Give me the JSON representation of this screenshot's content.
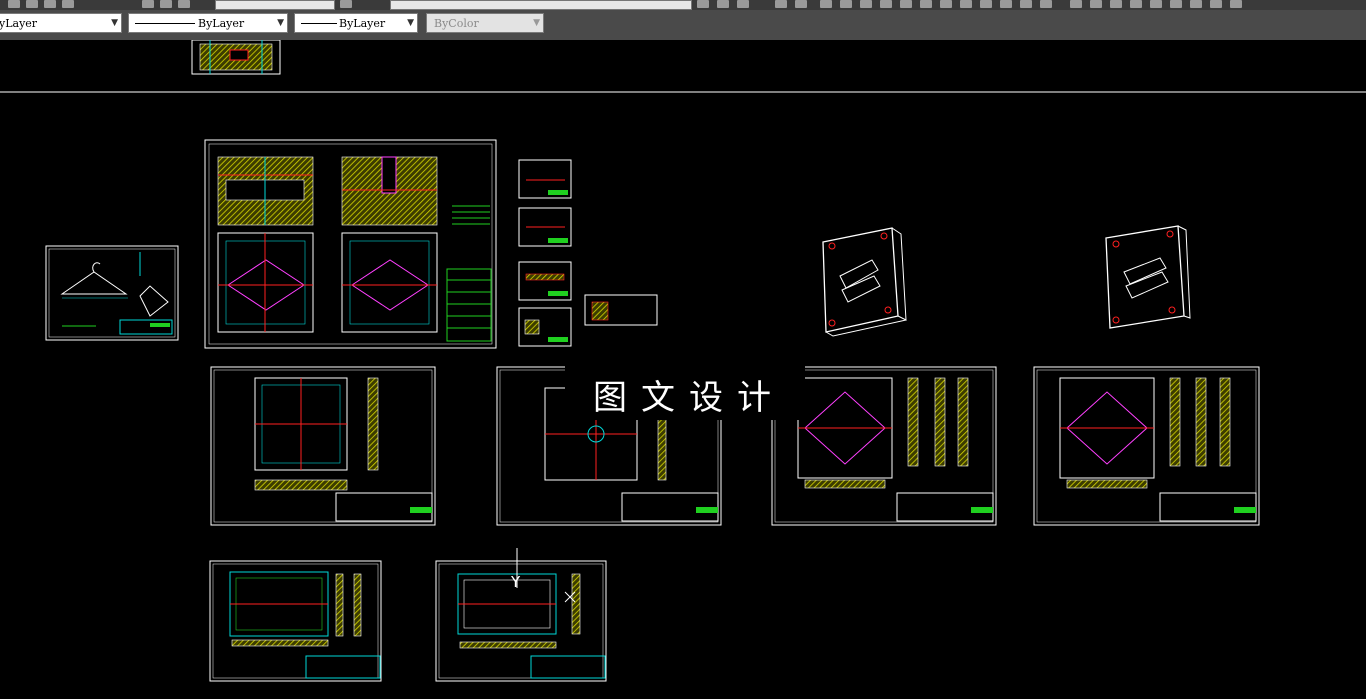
{
  "toolbar": {
    "file_tab_hint": "",
    "layer_tab_hint": ""
  },
  "properties": {
    "layer_value": "yLayer",
    "linetype_value": "ByLayer",
    "lineweight_value": "ByLayer",
    "color_value": "ByColor"
  },
  "watermark": {
    "text": "图文设计"
  },
  "ucs": {
    "y_label": "Y"
  },
  "colors": {
    "background": "#000000",
    "frame": "#ffffff",
    "hatch": "#c8c800",
    "cyan": "#00d8d8",
    "red": "#ff2020",
    "green": "#20d020",
    "magenta": "#ff40ff"
  }
}
